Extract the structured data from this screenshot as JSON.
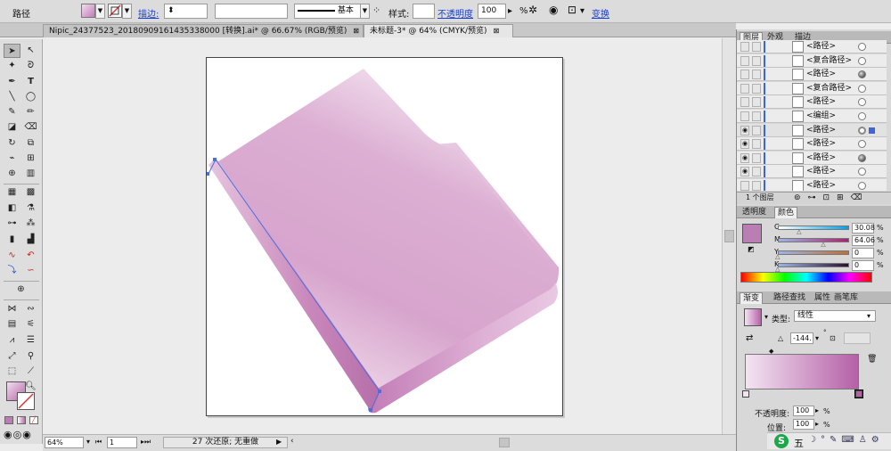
{
  "control_bar": {
    "object_type": "路径",
    "stroke_link": "描边:",
    "stroke_profile": "基本",
    "style_label": "样式:",
    "opacity_link": "不透明度",
    "opacity_value": "100",
    "opacity_unit": "%",
    "transform_link": "变换"
  },
  "tabs": [
    {
      "label": "Nipic_24377523_20180909161435338000  [转换].ai* @ 66.67% (RGB/预览)",
      "close": "⊠"
    },
    {
      "label": "未标题-3* @ 64% (CMYK/预览)",
      "close": "⊠"
    }
  ],
  "status_bar": {
    "zoom": "64%",
    "page": "1",
    "undo_text": "27 次还原; 无重做"
  },
  "layers_panel": {
    "tabs": [
      "图层",
      "外观",
      "描边"
    ],
    "rows": [
      {
        "name": "<路径>",
        "visible": false,
        "target": "hollow"
      },
      {
        "name": "<复合路径>",
        "visible": false,
        "target": "hollow"
      },
      {
        "name": "<路径>",
        "visible": false,
        "target": "filled"
      },
      {
        "name": "<复合路径>",
        "visible": false,
        "target": "hollow"
      },
      {
        "name": "<路径>",
        "visible": false,
        "target": "hollow"
      },
      {
        "name": "<编组>",
        "visible": false,
        "target": "hollow"
      },
      {
        "name": "<路径>",
        "visible": true,
        "target": "selected"
      },
      {
        "name": "<路径>",
        "visible": true,
        "target": "hollow"
      },
      {
        "name": "<路径>",
        "visible": true,
        "target": "filled"
      },
      {
        "name": "<路径>",
        "visible": true,
        "target": "hollow"
      },
      {
        "name": "<路径>",
        "visible": false,
        "target": "hollow"
      }
    ],
    "footer": "1 个图层"
  },
  "color_panel": {
    "tabs": [
      "透明度",
      "颜色"
    ],
    "channels": [
      {
        "label": "C",
        "value": "30.08",
        "unit": "%",
        "level": 0.3008
      },
      {
        "label": "M",
        "value": "64.06",
        "unit": "%",
        "level": 0.6406
      },
      {
        "label": "Y",
        "value": "0",
        "unit": "%",
        "level": 0
      },
      {
        "label": "K",
        "value": "0",
        "unit": "%",
        "level": 0
      }
    ],
    "fill_color": "#b97fb5"
  },
  "gradient_panel": {
    "tabs": [
      "渐变",
      "路径查找",
      "属性",
      "画笔库"
    ],
    "type_label": "类型:",
    "type_value": "线性",
    "angle_value": "-144.",
    "opacity_label": "不透明度:",
    "opacity_value": "100",
    "opacity_unit": "%",
    "location_label": "位置:",
    "location_value": "100",
    "location_unit": "%",
    "start_color": "#f3e4f1",
    "end_color": "#b560a8"
  },
  "ime_bar": {
    "logo": "S",
    "mode": "五"
  },
  "colors": {
    "folder_light": "#f6ecf4",
    "folder_mid": "#d7a3cc",
    "folder_dark": "#c47cb6",
    "selection": "#4a6fe0"
  }
}
